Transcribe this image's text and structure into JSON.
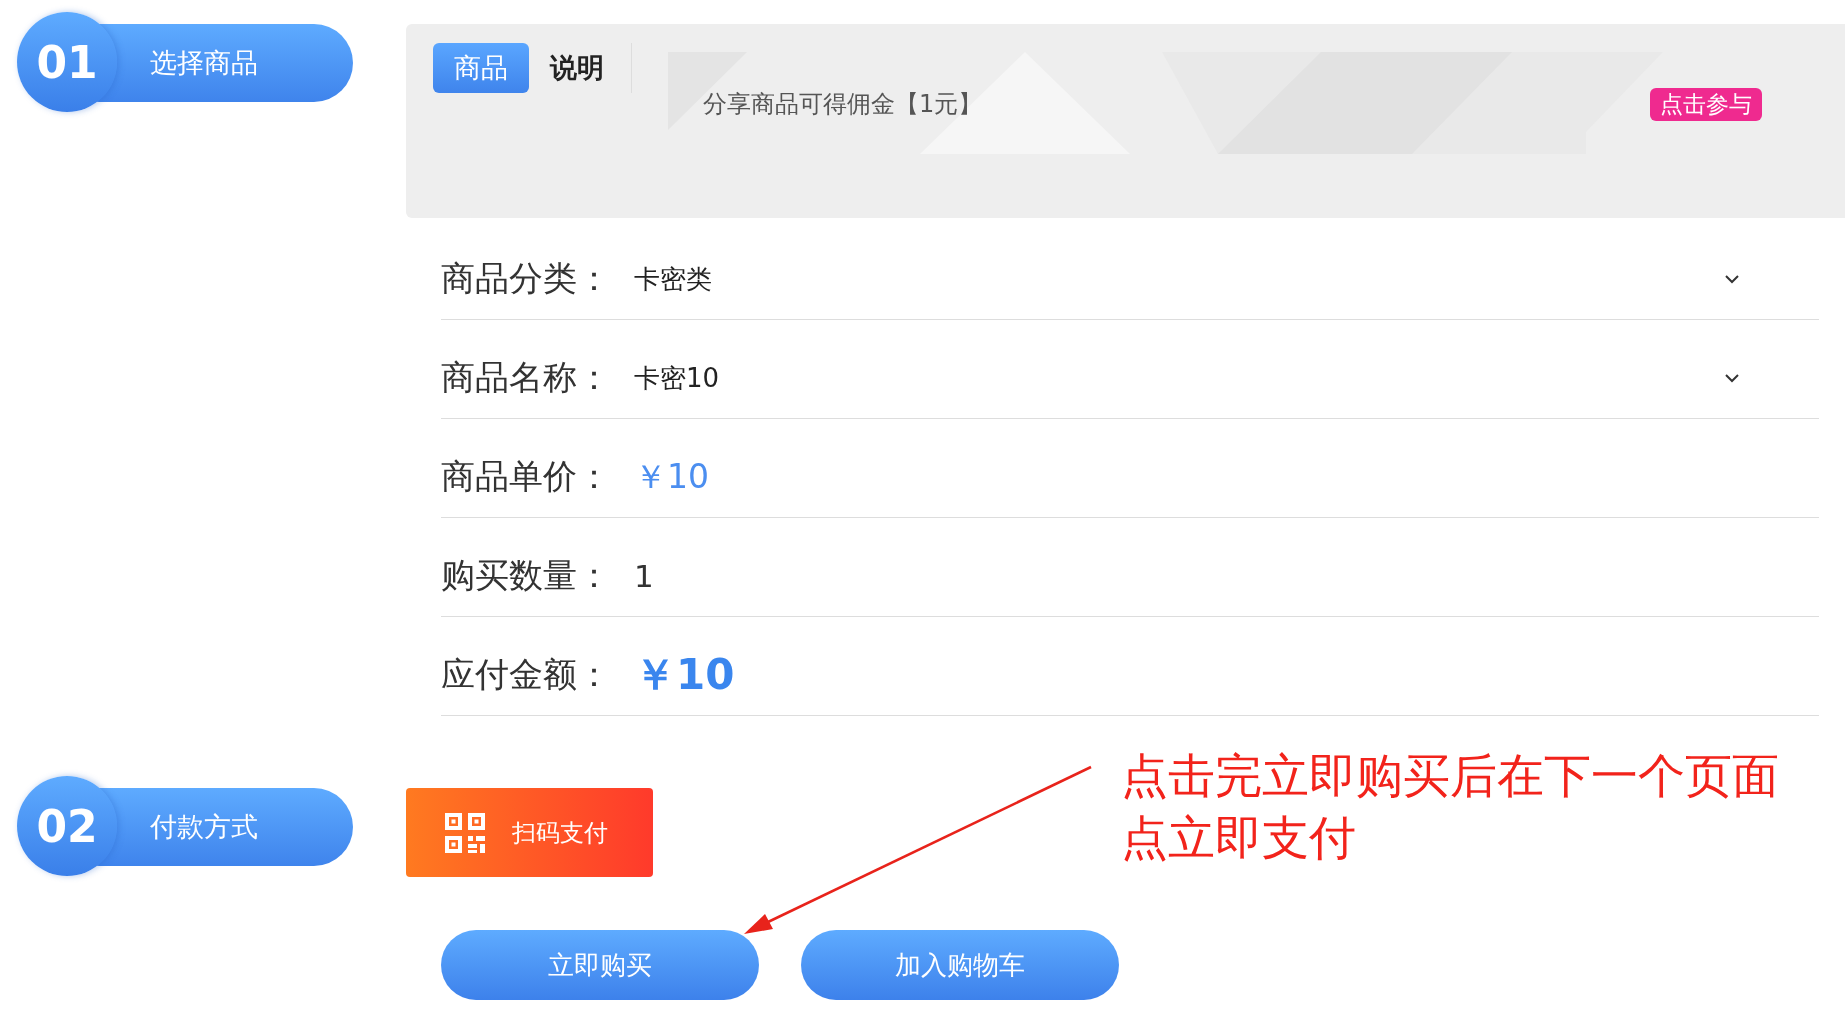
{
  "steps": [
    {
      "number": "01",
      "title": "选择商品"
    },
    {
      "number": "02",
      "title": "付款方式"
    }
  ],
  "tabs": [
    {
      "label": "商品",
      "selected": true
    },
    {
      "label": "说明",
      "selected": false
    }
  ],
  "promo": {
    "text": "分享商品可得佣金【1元】",
    "badge": "点击参与"
  },
  "form": {
    "rows": [
      {
        "kind": "select",
        "label": "商品分类：",
        "value": "卡密类"
      },
      {
        "kind": "select",
        "label": "商品名称：",
        "value": "卡密10"
      },
      {
        "kind": "price",
        "label": "商品单价：",
        "value": "￥10"
      },
      {
        "kind": "quantity",
        "label": "购买数量：",
        "value": "1"
      },
      {
        "kind": "total",
        "label": "应付金额：",
        "value": "￥10"
      }
    ]
  },
  "payment": {
    "methods": [
      {
        "label": "扫码支付",
        "selected": true
      }
    ]
  },
  "buttons": [
    "立即购买",
    "加入购物车"
  ],
  "annotation": {
    "text": "点击完立即购买后在下一个页面点立即支付"
  }
}
